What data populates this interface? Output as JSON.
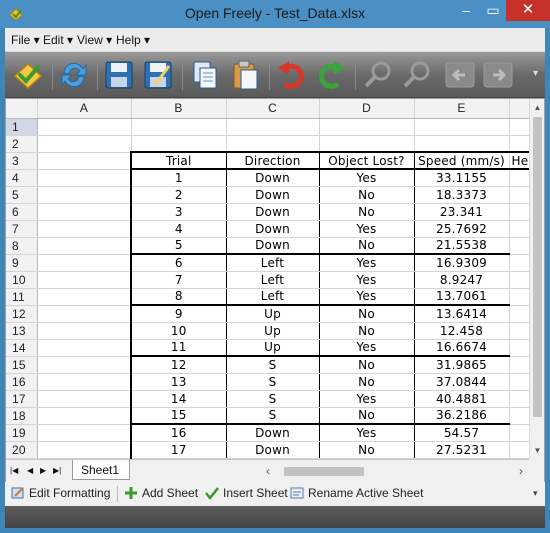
{
  "window": {
    "title": "Open Freely - Test_Data.xlsx"
  },
  "menu": [
    {
      "label": "File ▾"
    },
    {
      "label": "Edit ▾"
    },
    {
      "label": "View ▾"
    },
    {
      "label": "Help ▾"
    }
  ],
  "toolbar_icons": [
    "open-icon",
    "refresh-icon",
    "save-icon",
    "save-as-icon",
    "copy-icon",
    "paste-icon",
    "undo-icon",
    "redo-icon",
    "zoom-in-icon",
    "zoom-out-icon",
    "back-icon",
    "forward-icon"
  ],
  "grid": {
    "columns": [
      "A",
      "B",
      "C",
      "D",
      "E"
    ],
    "partial_column_text": "He",
    "rows": [
      {
        "n": "1",
        "cells": [
          "",
          "",
          "",
          "",
          ""
        ]
      },
      {
        "n": "2",
        "cells": [
          "",
          "",
          "",
          "",
          ""
        ]
      },
      {
        "n": "3",
        "cells": [
          "",
          "Trial",
          "Direction",
          "Object Lost?",
          "Speed (mm/s)"
        ]
      },
      {
        "n": "4",
        "cells": [
          "",
          "1",
          "Down",
          "Yes",
          "33.1155"
        ]
      },
      {
        "n": "5",
        "cells": [
          "",
          "2",
          "Down",
          "No",
          "18.3373"
        ]
      },
      {
        "n": "6",
        "cells": [
          "",
          "3",
          "Down",
          "No",
          "23.341"
        ]
      },
      {
        "n": "7",
        "cells": [
          "",
          "4",
          "Down",
          "Yes",
          "25.7692"
        ]
      },
      {
        "n": "8",
        "cells": [
          "",
          "5",
          "Down",
          "No",
          "21.5538"
        ]
      },
      {
        "n": "9",
        "cells": [
          "",
          "6",
          "Left",
          "Yes",
          "16.9309"
        ]
      },
      {
        "n": "10",
        "cells": [
          "",
          "7",
          "Left",
          "Yes",
          "8.9247"
        ]
      },
      {
        "n": "11",
        "cells": [
          "",
          "8",
          "Left",
          "Yes",
          "13.7061"
        ]
      },
      {
        "n": "12",
        "cells": [
          "",
          "9",
          "Up",
          "No",
          "13.6414"
        ]
      },
      {
        "n": "13",
        "cells": [
          "",
          "10",
          "Up",
          "No",
          "12.458"
        ]
      },
      {
        "n": "14",
        "cells": [
          "",
          "11",
          "Up",
          "Yes",
          "16.6674"
        ]
      },
      {
        "n": "15",
        "cells": [
          "",
          "12",
          "S",
          "No",
          "31.9865"
        ]
      },
      {
        "n": "16",
        "cells": [
          "",
          "13",
          "S",
          "No",
          "37.0844"
        ]
      },
      {
        "n": "17",
        "cells": [
          "",
          "14",
          "S",
          "Yes",
          "40.4881"
        ]
      },
      {
        "n": "18",
        "cells": [
          "",
          "15",
          "S",
          "No",
          "36.2186"
        ]
      },
      {
        "n": "19",
        "cells": [
          "",
          "16",
          "Down",
          "Yes",
          "54.57"
        ]
      },
      {
        "n": "20",
        "cells": [
          "",
          "17",
          "Down",
          "No",
          "27.5231"
        ]
      }
    ]
  },
  "sheet_tabs": [
    {
      "label": "Sheet1"
    }
  ],
  "bottom_actions": [
    {
      "label": "Edit Formatting"
    },
    {
      "label": "Add Sheet"
    },
    {
      "label": "Insert Sheet"
    },
    {
      "label": "Rename Active Sheet"
    }
  ]
}
